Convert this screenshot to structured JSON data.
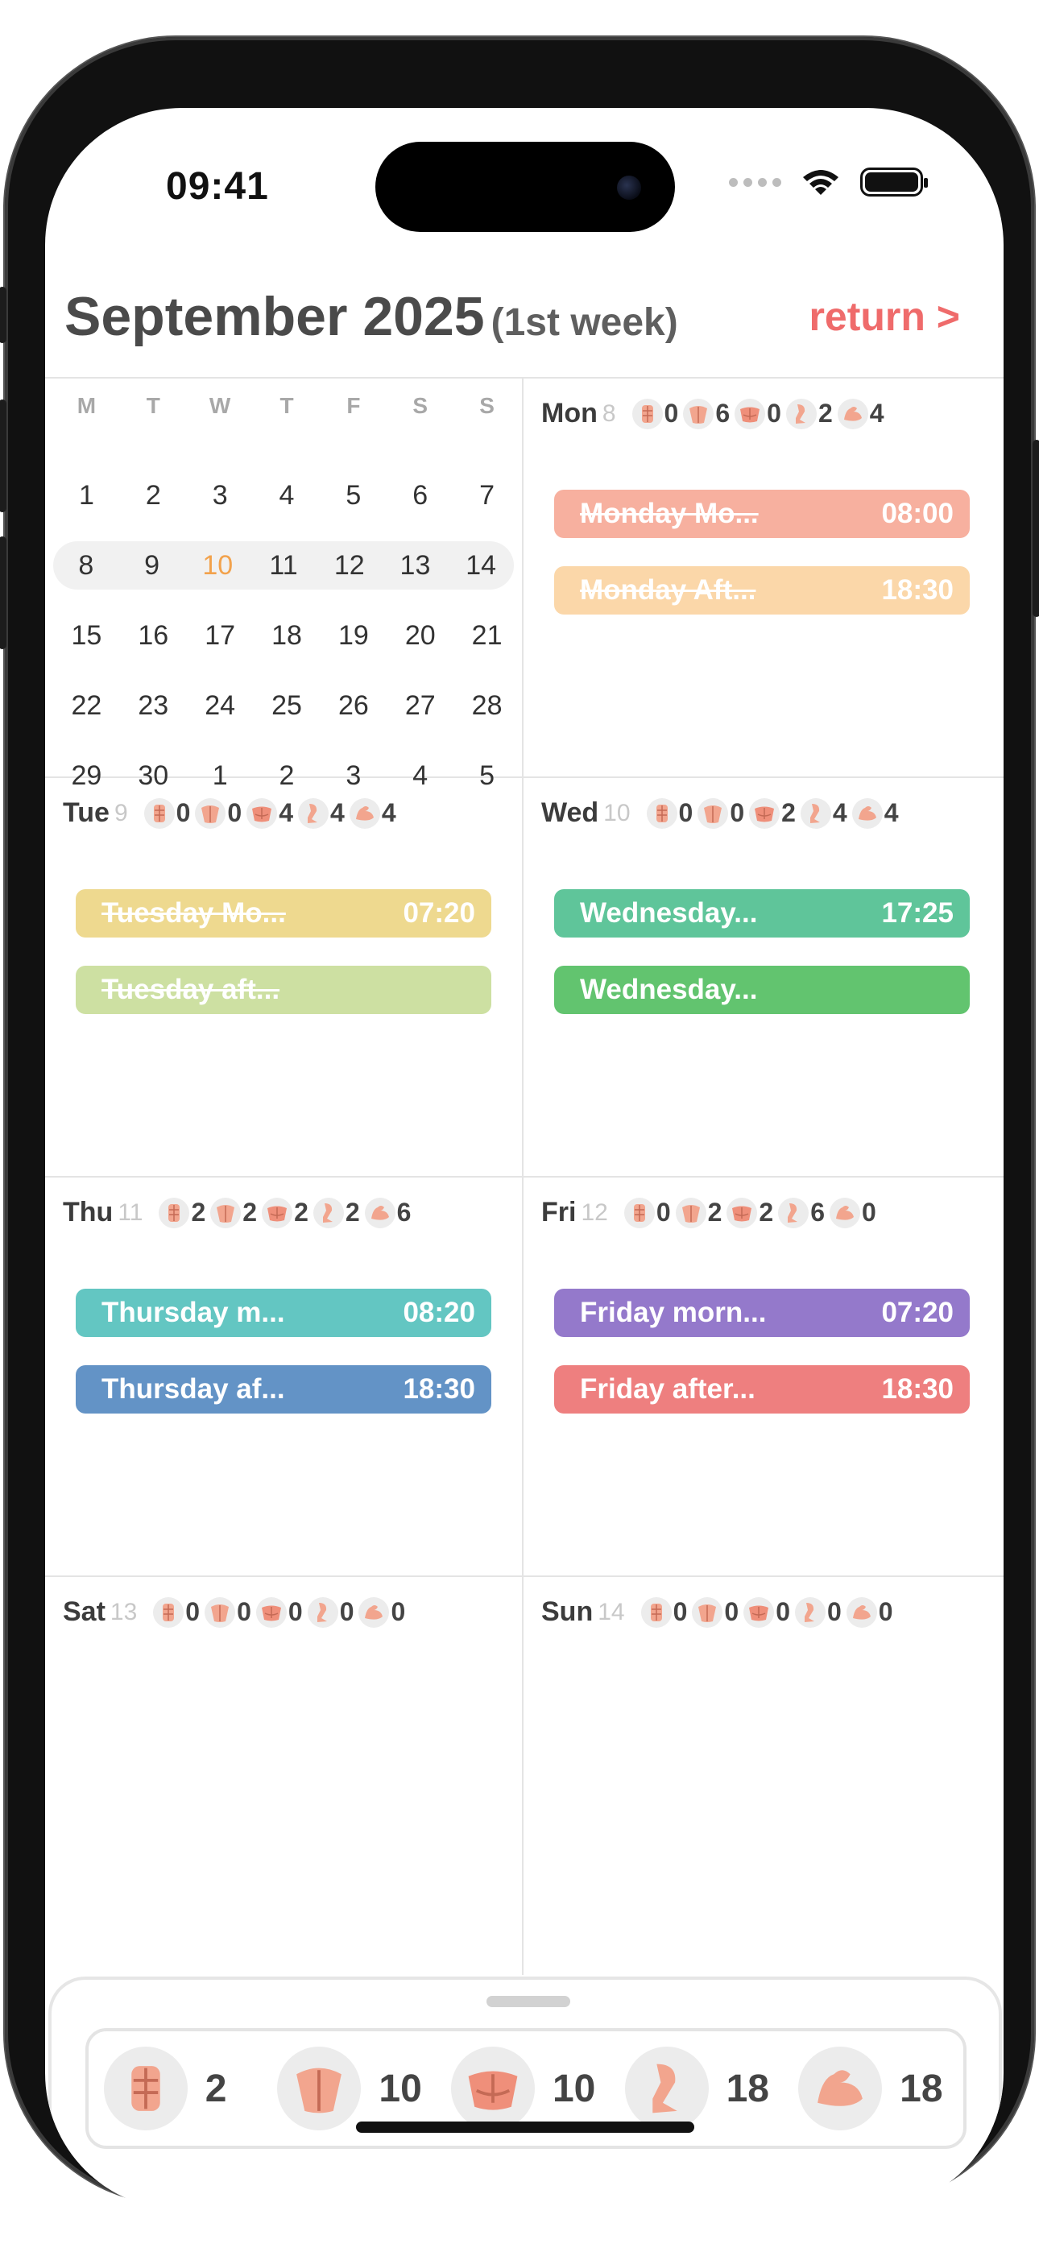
{
  "status": {
    "time": "09:41"
  },
  "header": {
    "title": "September 2025",
    "subtitle": "(1st week)",
    "return_label": "return >"
  },
  "calendar": {
    "dow": [
      "M",
      "T",
      "W",
      "T",
      "F",
      "S",
      "S"
    ],
    "weeks": [
      [
        "1",
        "2",
        "3",
        "4",
        "5",
        "6",
        "7"
      ],
      [
        "8",
        "9",
        "10",
        "11",
        "12",
        "13",
        "14"
      ],
      [
        "15",
        "16",
        "17",
        "18",
        "19",
        "20",
        "21"
      ],
      [
        "22",
        "23",
        "24",
        "25",
        "26",
        "27",
        "28"
      ],
      [
        "29",
        "30",
        "1",
        "2",
        "3",
        "4",
        "5"
      ]
    ],
    "highlight_week": 1,
    "today": "10"
  },
  "muscle_icons": [
    "abs-icon",
    "back-icon",
    "chest-icon",
    "leg-icon",
    "arm-icon"
  ],
  "days": [
    {
      "name": "Mon",
      "num": "8",
      "counts": [
        "0",
        "6",
        "0",
        "2",
        "4"
      ],
      "events": [
        {
          "title": "Monday Mo...",
          "time": "08:00",
          "color": "#f7b09f",
          "done": true
        },
        {
          "title": "Monday Aft...",
          "time": "18:30",
          "color": "#fbd7a9",
          "done": true
        }
      ]
    },
    {
      "name": "Tue",
      "num": "9",
      "counts": [
        "0",
        "0",
        "4",
        "4",
        "4"
      ],
      "events": [
        {
          "title": "Tuesday Mo...",
          "time": "07:20",
          "color": "#eed98f",
          "done": true
        },
        {
          "title": "Tuesday aft...",
          "time": "",
          "color": "#cde0a2",
          "done": true
        }
      ]
    },
    {
      "name": "Wed",
      "num": "10",
      "counts": [
        "0",
        "0",
        "2",
        "4",
        "4"
      ],
      "events": [
        {
          "title": "Wednesday...",
          "time": "17:25",
          "color": "#5fc59a",
          "done": false
        },
        {
          "title": "Wednesday...",
          "time": "",
          "color": "#62c46f",
          "done": false
        }
      ]
    },
    {
      "name": "Thu",
      "num": "11",
      "counts": [
        "2",
        "2",
        "2",
        "2",
        "6"
      ],
      "events": [
        {
          "title": "Thursday m...",
          "time": "08:20",
          "color": "#63c6c2",
          "done": false
        },
        {
          "title": "Thursday af...",
          "time": "18:30",
          "color": "#6393c6",
          "done": false
        }
      ]
    },
    {
      "name": "Fri",
      "num": "12",
      "counts": [
        "0",
        "2",
        "2",
        "6",
        "0"
      ],
      "events": [
        {
          "title": "Friday morn...",
          "time": "07:20",
          "color": "#9479cb",
          "done": false
        },
        {
          "title": "Friday after...",
          "time": "18:30",
          "color": "#ee7f7f",
          "done": false
        }
      ]
    },
    {
      "name": "Sat",
      "num": "13",
      "counts": [
        "0",
        "0",
        "0",
        "0",
        "0"
      ],
      "events": []
    },
    {
      "name": "Sun",
      "num": "14",
      "counts": [
        "0",
        "0",
        "0",
        "0",
        "0"
      ],
      "events": []
    }
  ],
  "summary": [
    "2",
    "10",
    "10",
    "18",
    "18"
  ],
  "colors": {
    "accent": "#ef6b6b",
    "today": "#f2a24c"
  }
}
